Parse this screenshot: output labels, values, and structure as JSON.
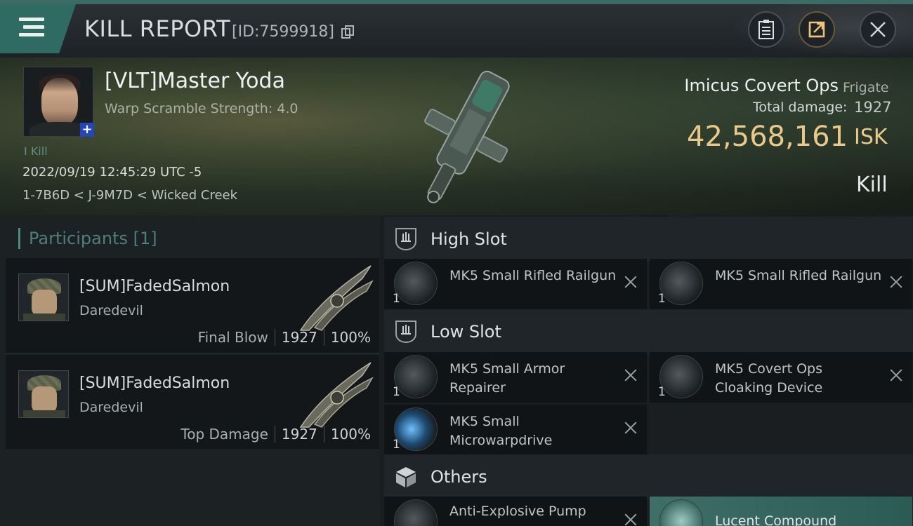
{
  "header": {
    "title": "KILL REPORT",
    "report_id": "[ID:7599918]"
  },
  "victim": {
    "name": "[VLT]Master Yoda",
    "warp_scramble": "Warp Scramble Strength: 4.0",
    "kill_tag": "Kill",
    "datetime": "2022/09/19 12:45:29 UTC -5",
    "location": "1-7B6D < J-9M7D < Wicked Creek"
  },
  "ship": {
    "name": "Imicus Covert Ops",
    "class": "Frigate",
    "total_damage_label": "Total damage:",
    "total_damage": "1927",
    "isk_value": "42,568,161",
    "isk_unit": "ISK",
    "result": "Kill"
  },
  "participants": {
    "heading": "Participants [1]",
    "rows": [
      {
        "name": "[SUM]FadedSalmon",
        "ship": "Daredevil",
        "role": "Final Blow",
        "damage": "1927",
        "percent": "100%"
      },
      {
        "name": "[SUM]FadedSalmon",
        "ship": "Daredevil",
        "role": "Top Damage",
        "damage": "1927",
        "percent": "100%"
      }
    ]
  },
  "fittings": {
    "high_slot": {
      "label": "High Slot",
      "modules": [
        {
          "qty": "1",
          "name": "MK5 Small Rifled Railgun"
        },
        {
          "qty": "1",
          "name": "MK5 Small Rifled Railgun"
        }
      ]
    },
    "low_slot": {
      "label": "Low Slot",
      "modules": [
        {
          "qty": "1",
          "name": "MK5 Small Armor Repairer"
        },
        {
          "qty": "1",
          "name": "MK5 Covert Ops Cloaking Device"
        },
        {
          "qty": "1",
          "name": "MK5 Small Microwarpdrive"
        }
      ]
    },
    "others": {
      "label": "Others",
      "modules": [
        {
          "qty": "",
          "name": "Anti-Explosive Pump"
        },
        {
          "qty": "",
          "name": "Lucent Compound"
        }
      ]
    }
  },
  "icons": {
    "menu": "hamburger-icon",
    "copy": "copy-icon",
    "clipboard": "clipboard-icon",
    "share": "share-icon",
    "close": "close-icon",
    "remove": "x-icon"
  },
  "colors": {
    "accent_teal": "#2f6a63",
    "isk_gold": "#e8c98a",
    "corp_badge": "#2546b8"
  }
}
